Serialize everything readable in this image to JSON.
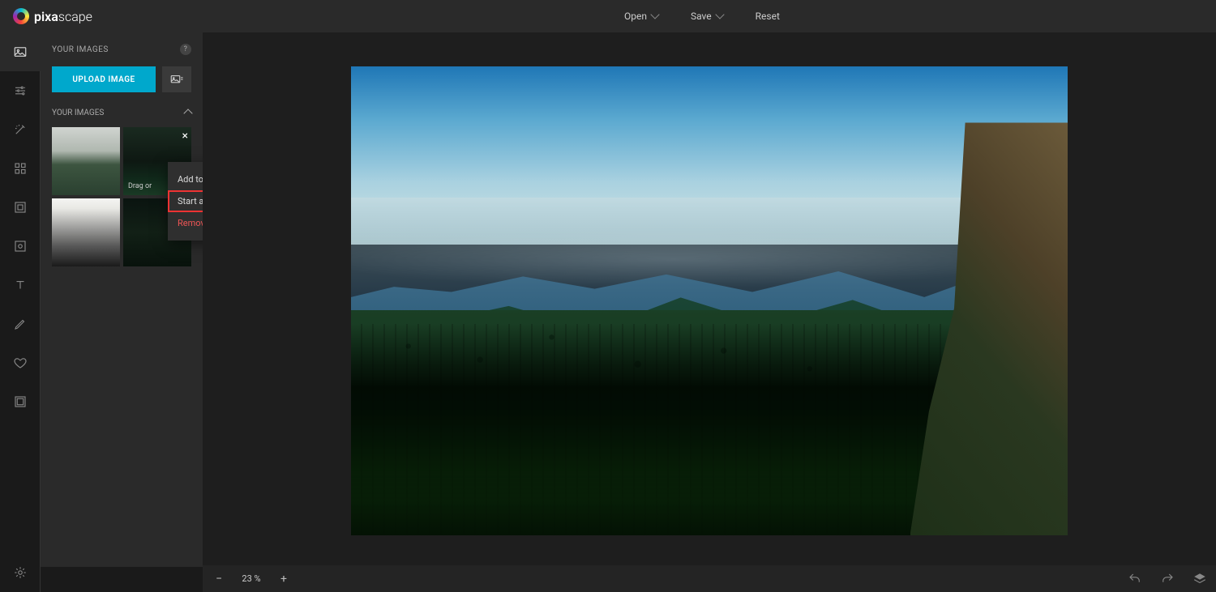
{
  "app": {
    "name_bold": "pixa",
    "name_light": "scape"
  },
  "header": {
    "open": "Open",
    "save": "Save",
    "reset": "Reset"
  },
  "sidebar": {
    "title": "YOUR IMAGES",
    "upload": "UPLOAD IMAGE",
    "section_label": "YOUR IMAGES",
    "drag_hint": "Drag or"
  },
  "context_menu": {
    "add": "Add to Project",
    "start": "Start as New Project",
    "remove": "Remove"
  },
  "zoom": {
    "value": "23 %"
  }
}
